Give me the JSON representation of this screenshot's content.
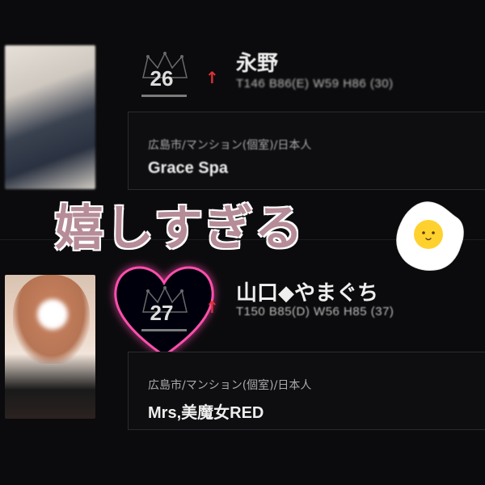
{
  "entries": [
    {
      "rank": "26",
      "trend": "↑",
      "name": "永野",
      "spec": "T146 B86(E) W59 H86 (30)",
      "area": "広島市/マンション(個室)/日本人",
      "shop": "Grace Spa"
    },
    {
      "rank": "27",
      "trend": "↑",
      "name": "山口◆やまぐち",
      "spec": "T150 B85(D) W56 H85 (37)",
      "area": "広島市/マンション(個室)/日本人",
      "shop": "Mrs,美魔女RED"
    }
  ],
  "overlay": {
    "caption": "嬉しすぎる"
  },
  "colors": {
    "caption": "#b58c97",
    "trend_arrow": "#e0303a",
    "heart_glow": "#ff4fae"
  },
  "icons": [
    "crown-icon",
    "up-arrow-icon",
    "heart-sticker-icon",
    "fried-egg-sticker-icon"
  ]
}
